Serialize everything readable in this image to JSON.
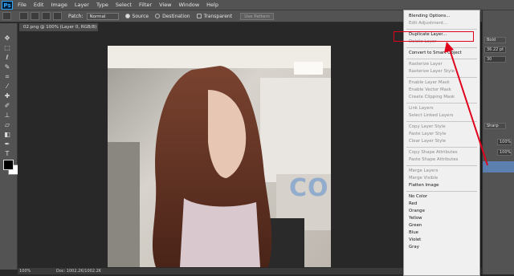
{
  "menubar": {
    "logo": "Ps",
    "items": [
      "File",
      "Edit",
      "Image",
      "Layer",
      "Type",
      "Select",
      "Filter",
      "View",
      "Window",
      "Help"
    ]
  },
  "options_bar": {
    "patch_label": "Patch:",
    "patch_value": "Normal",
    "source_label": "Source",
    "destination_label": "Destination",
    "transparent_label": "Transparent",
    "use_pattern_label": "Use Pattern"
  },
  "document": {
    "tab_title": "02.png @ 100% (Layer 0, RGB/8)",
    "zoom": "100%",
    "doc_size": "Doc: 1002.2K/1002.2K",
    "watermark": "COBA"
  },
  "right_panel": {
    "font_style": "Bold",
    "leading": "36.22 pt",
    "tracking": "30",
    "anti_alias": "Sharp",
    "opacity": "100%",
    "fill": "100%"
  },
  "context_menu": {
    "items": [
      {
        "label": "Blending Options...",
        "disabled": false
      },
      {
        "label": "Edit Adjustment...",
        "disabled": true
      },
      {
        "sep": true
      },
      {
        "label": "Duplicate Layer...",
        "disabled": false,
        "highlighted": true
      },
      {
        "label": "Delete Layer",
        "disabled": true
      },
      {
        "sep": true
      },
      {
        "label": "Convert to Smart Object",
        "disabled": false
      },
      {
        "sep": true
      },
      {
        "label": "Rasterize Layer",
        "disabled": true
      },
      {
        "label": "Rasterize Layer Style",
        "disabled": true
      },
      {
        "sep": true
      },
      {
        "label": "Enable Layer Mask",
        "disabled": true
      },
      {
        "label": "Enable Vector Mask",
        "disabled": true
      },
      {
        "label": "Create Clipping Mask",
        "disabled": true
      },
      {
        "sep": true
      },
      {
        "label": "Link Layers",
        "disabled": true
      },
      {
        "label": "Select Linked Layers",
        "disabled": true
      },
      {
        "sep": true
      },
      {
        "label": "Copy Layer Style",
        "disabled": true
      },
      {
        "label": "Paste Layer Style",
        "disabled": true
      },
      {
        "label": "Clear Layer Style",
        "disabled": true
      },
      {
        "sep": true
      },
      {
        "label": "Copy Shape Attributes",
        "disabled": true
      },
      {
        "label": "Paste Shape Attributes",
        "disabled": true
      },
      {
        "sep": true
      },
      {
        "label": "Merge Layers",
        "disabled": true
      },
      {
        "label": "Merge Visible",
        "disabled": true
      },
      {
        "label": "Flatten Image",
        "disabled": false
      },
      {
        "sep": true
      },
      {
        "label": "No Color",
        "disabled": false
      },
      {
        "label": "Red",
        "disabled": false
      },
      {
        "label": "Orange",
        "disabled": false
      },
      {
        "label": "Yellow",
        "disabled": false
      },
      {
        "label": "Green",
        "disabled": false
      },
      {
        "label": "Blue",
        "disabled": false
      },
      {
        "label": "Violet",
        "disabled": false
      },
      {
        "label": "Gray",
        "disabled": false
      }
    ]
  },
  "colors": {
    "highlight": "#e0001b",
    "ui_bg": "#535353",
    "workspace": "#282828"
  }
}
